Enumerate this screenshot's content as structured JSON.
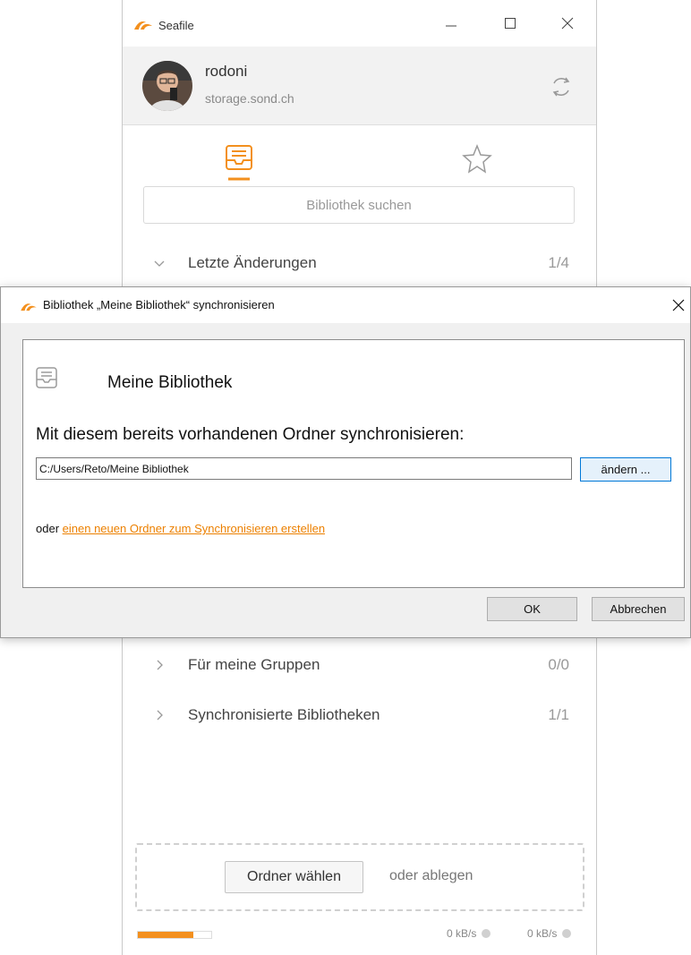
{
  "main_window": {
    "title": "Seafile",
    "account": {
      "name": "rodoni",
      "server": "storage.sond.ch"
    },
    "search_placeholder": "Bibliothek suchen",
    "sections": [
      {
        "label": "Letzte Änderungen",
        "count": "1/4",
        "expanded": true
      },
      {
        "label": "Für meine Gruppen",
        "count": "0/0",
        "expanded": false
      },
      {
        "label": "Synchronisierte Bibliotheken",
        "count": "1/1",
        "expanded": false
      }
    ],
    "dropzone": {
      "button_label": "Ordner wählen",
      "or_text": "oder ablegen"
    },
    "footer": {
      "upload_speed": "0 kB/s",
      "download_speed": "0 kB/s",
      "progress_fraction": 0.75
    },
    "icons": {
      "logo": "seafile-logo-icon",
      "minimize": "minimize-icon",
      "maximize": "maximize-icon",
      "close": "close-icon",
      "refresh": "refresh-icon",
      "library_tab": "library-tray-icon",
      "starred_tab": "star-icon"
    }
  },
  "dialog": {
    "title": "Bibliothek „Meine Bibliothek“ synchronisieren",
    "library_name": "Meine Bibliothek",
    "question": "Mit diesem bereits vorhandenen Ordner synchronisieren:",
    "path_value": "C:/Users/Reto/Meine Bibliothek",
    "change_button": "ändern ...",
    "or_prefix": "oder",
    "create_link": "einen neuen Ordner zum Synchronisieren erstellen",
    "ok_button": "OK",
    "cancel_button": "Abbrechen"
  },
  "colors": {
    "accent": "#f3901e",
    "link": "#ec8000",
    "focus_border": "#0078d7"
  }
}
